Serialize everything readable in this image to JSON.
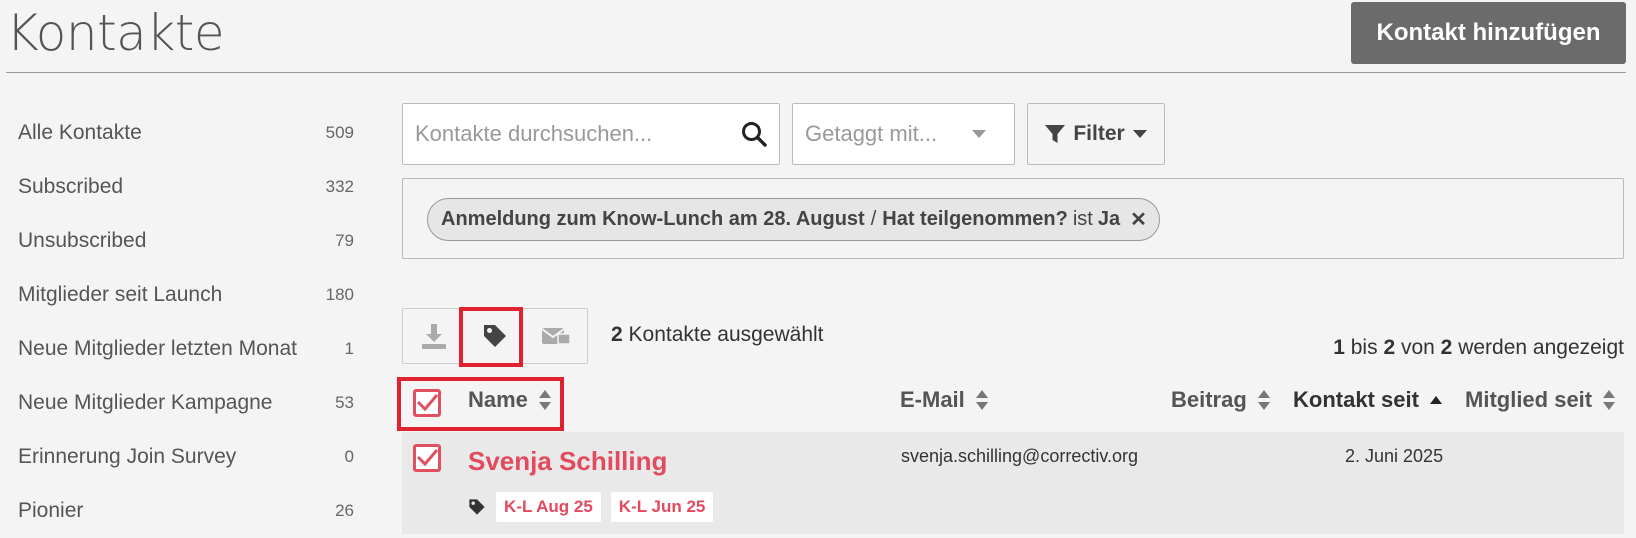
{
  "header": {
    "title": "Kontakte",
    "add_button": "Kontakt hinzufügen"
  },
  "sidebar": {
    "items": [
      {
        "label": "Alle Kontakte",
        "count": "509"
      },
      {
        "label": "Subscribed",
        "count": "332"
      },
      {
        "label": "Unsubscribed",
        "count": "79"
      },
      {
        "label": "Mitglieder seit Launch",
        "count": "180"
      },
      {
        "label": "Neue Mitglieder letzten Monat",
        "count": "1"
      },
      {
        "label": "Neue Mitglieder Kampagne",
        "count": "53"
      },
      {
        "label": "Erinnerung Join Survey",
        "count": "0"
      },
      {
        "label": "Pionier",
        "count": "26"
      }
    ]
  },
  "search": {
    "placeholder": "Kontakte durchsuchen..."
  },
  "tag_filter": {
    "placeholder": "Getaggt mit..."
  },
  "filter_button": "Filter",
  "active_filter": {
    "field": "Anmeldung zum Know-Lunch am 28. August",
    "separator": "/",
    "question": "Hat teilgenommen?",
    "operator": "ist",
    "value": "Ja"
  },
  "toolbar": {
    "icons": [
      "download-icon",
      "tag-icon",
      "mail-icon"
    ]
  },
  "selection": {
    "count": "2",
    "label": "Kontakte ausgewählt"
  },
  "pagination": {
    "from": "1",
    "word_to": "bis",
    "to": "2",
    "word_of": "von",
    "total": "2",
    "suffix": "werden angezeigt"
  },
  "table": {
    "columns": {
      "name": "Name",
      "email": "E-Mail",
      "beitrag": "Beitrag",
      "kontakt_seit": "Kontakt seit",
      "mitglied_seit": "Mitglied seit"
    },
    "rows": [
      {
        "name": "Svenja Schilling",
        "email": "svenja.schilling@correctiv.org",
        "kontakt_seit": "2. Juni 2025",
        "tags": [
          "K-L Aug 25",
          "K-L Jun 25"
        ],
        "checked": true
      }
    ]
  },
  "colors": {
    "accent": "#e24a5d",
    "highlight_box": "#e0212e",
    "button_bg": "#6b6b6b"
  }
}
